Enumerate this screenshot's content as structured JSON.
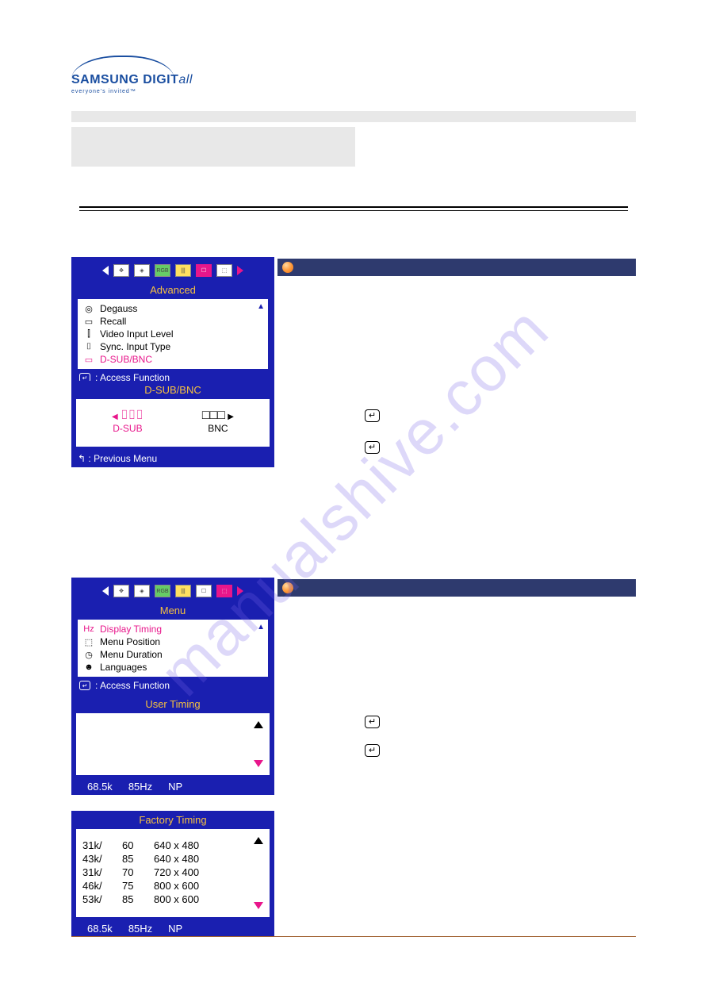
{
  "logo": {
    "main_a": "SAMSUNG DIGIT",
    "main_b": "all",
    "sub": "everyone's invited™"
  },
  "watermark": "manualshive.com",
  "osd_advanced": {
    "title": "Advanced",
    "items": [
      {
        "icon": "◎",
        "label": "Degauss"
      },
      {
        "icon": "▭",
        "label": "Recall"
      },
      {
        "icon": "⫿",
        "label": "Video Input Level"
      },
      {
        "icon": "⌷",
        "label": "Sync. Input Type"
      },
      {
        "icon": "▭",
        "label": "D-SUB/BNC",
        "sel": true
      }
    ],
    "footer_sym": "↵",
    "footer": ": Access Function"
  },
  "osd_dsub": {
    "title": "D-SUB/BNC",
    "left": {
      "arrow": "◀",
      "conn": "⌷⌷⌷",
      "label": "D-SUB"
    },
    "right": {
      "conn": "□□□",
      "arrow": "▶",
      "label": "BNC"
    },
    "footer_sym": "↰",
    "footer": ": Previous Menu"
  },
  "osd_menu": {
    "title": "Menu",
    "items": [
      {
        "icon": "Hz",
        "label": "Display Timing",
        "sel": true
      },
      {
        "icon": "⬚",
        "label": "Menu Position"
      },
      {
        "icon": "◷",
        "label": "Menu Duration"
      },
      {
        "icon": "☻",
        "label": "Languages"
      }
    ],
    "footer_sym": "↵",
    "footer": ": Access Function"
  },
  "osd_user_timing": {
    "title": "User Timing",
    "foot": {
      "a": "68.5k",
      "b": "85Hz",
      "c": "NP"
    }
  },
  "osd_factory_timing": {
    "title": "Factory Timing",
    "rows": [
      {
        "a": "31k/",
        "b": "60",
        "c": "640 x 480"
      },
      {
        "a": "43k/",
        "b": "85",
        "c": "640 x 480"
      },
      {
        "a": "31k/",
        "b": "70",
        "c": "720 x 400"
      },
      {
        "a": "46k/",
        "b": "75",
        "c": "800 x 600"
      },
      {
        "a": "53k/",
        "b": "85",
        "c": "800 x 600"
      }
    ],
    "foot": {
      "a": "68.5k",
      "b": "85Hz",
      "c": "NP"
    }
  },
  "enter_symbol": "↵"
}
